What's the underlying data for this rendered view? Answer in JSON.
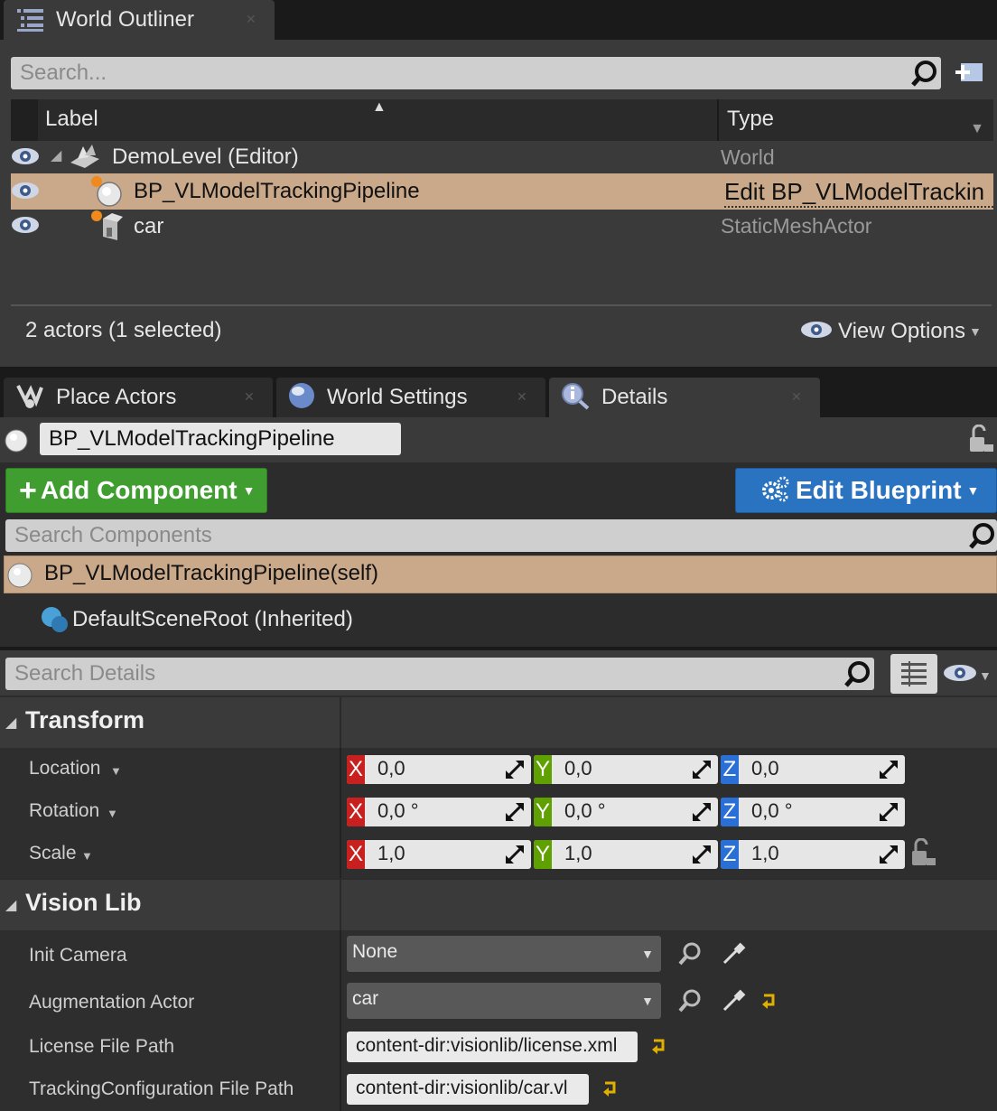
{
  "outliner": {
    "tab_title": "World Outliner",
    "search_placeholder": "Search...",
    "columns": {
      "label": "Label",
      "type": "Type"
    },
    "rows": [
      {
        "label": "DemoLevel (Editor)",
        "type": "World",
        "icon": "world-level-icon"
      },
      {
        "label": "BP_VLModelTrackingPipeline",
        "type": "Edit BP_VLModelTrackin",
        "icon": "blueprint-actor-icon",
        "selected": true
      },
      {
        "label": "car",
        "type": "StaticMeshActor",
        "icon": "static-mesh-actor-icon"
      }
    ],
    "status": "2 actors (1 selected)",
    "view_options": "View Options"
  },
  "tabs": [
    {
      "label": "Place Actors",
      "icon": "place-actors-icon"
    },
    {
      "label": "World Settings",
      "icon": "globe-icon"
    },
    {
      "label": "Details",
      "icon": "info-icon"
    }
  ],
  "details": {
    "actor_name": "BP_VLModelTrackingPipeline",
    "add_component": "Add Component",
    "edit_blueprint": "Edit Blueprint",
    "search_components": "Search Components",
    "components": [
      {
        "label": "BP_VLModelTrackingPipeline(self)",
        "selected": true
      },
      {
        "label": "DefaultSceneRoot (Inherited)"
      }
    ],
    "search_details": "Search Details",
    "transform": {
      "header": "Transform",
      "location": {
        "label": "Location",
        "x": "0,0",
        "y": "0,0",
        "z": "0,0"
      },
      "rotation": {
        "label": "Rotation",
        "x": "0,0 °",
        "y": "0,0 °",
        "z": "0,0 °"
      },
      "scale": {
        "label": "Scale",
        "x": "1,0",
        "y": "1,0",
        "z": "1,0"
      },
      "axis_x": "X",
      "axis_y": "Y",
      "axis_z": "Z"
    },
    "vision_lib": {
      "header": "Vision Lib",
      "init_camera": {
        "label": "Init Camera",
        "value": "None"
      },
      "augmentation_actor": {
        "label": "Augmentation Actor",
        "value": "car"
      },
      "license_path": {
        "label": "License File Path",
        "value": "content-dir:visionlib/license.xml"
      },
      "tracking_config": {
        "label": "TrackingConfiguration File Path",
        "value": "content-dir:visionlib/car.vl"
      }
    }
  },
  "colors": {
    "selection": "#c9a98a",
    "add_component_green": "#3f9e2f",
    "edit_blueprint_blue": "#2a73c0",
    "axis_x": "#c8201e",
    "axis_y": "#5fa100",
    "axis_z": "#2a6fd6"
  }
}
